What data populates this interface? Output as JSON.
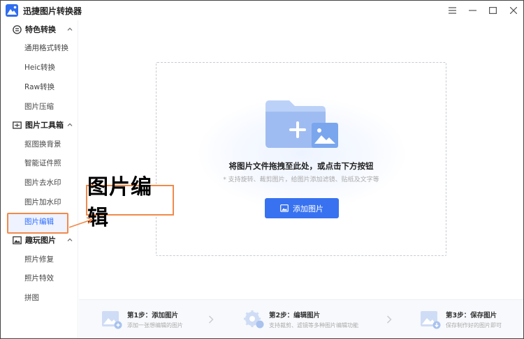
{
  "app": {
    "title": "迅捷图片转换器"
  },
  "window_controls": [
    "menu-icon",
    "minimize-icon",
    "maximize-icon",
    "close-icon"
  ],
  "sidebar": {
    "groups": [
      {
        "label": "特色转换",
        "icon": "convert-icon",
        "items": [
          "通用格式转换",
          "Heic转换",
          "Raw转换",
          "图片压缩"
        ]
      },
      {
        "label": "图片工具箱",
        "icon": "toolbox-icon",
        "items": [
          "抠图换背景",
          "智能证件照",
          "图片去水印",
          "图片加水印",
          "图片编辑"
        ]
      },
      {
        "label": "趣玩图片",
        "icon": "image-icon",
        "items": [
          "照片修复",
          "照片特效",
          "拼图"
        ]
      }
    ],
    "active_item": "图片编辑"
  },
  "drop_area": {
    "title": "将图片文件拖拽至此处，或点击下方按钮",
    "subtitle": "* 支持旋转、裁剪图片，给图片添加滤镜、贴纸及文字等",
    "add_button": "添加图片"
  },
  "callout": {
    "text": "图片编辑"
  },
  "steps": [
    {
      "title": "第1步：添加图片",
      "desc": "添加一张想编辑的图片"
    },
    {
      "title": "第2步：编辑图片",
      "desc": "支持裁剪、滤镜等多种图片编辑功能"
    },
    {
      "title": "第3步：保存图片",
      "desc": "保存制作好的图片即可"
    }
  ],
  "colors": {
    "accent": "#3872f0",
    "highlight": "#f08a4b",
    "active_text": "#2b6bff"
  }
}
